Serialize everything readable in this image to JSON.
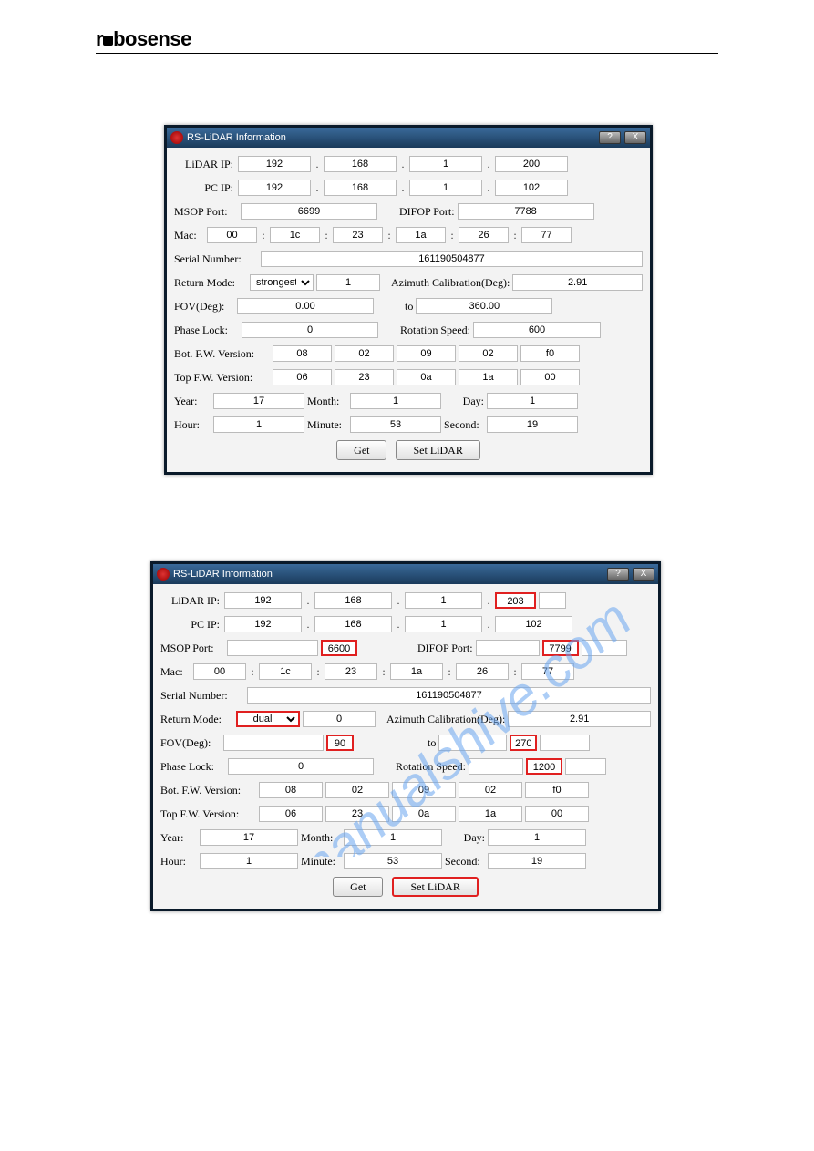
{
  "brand": "robosense",
  "watermark": "manualshive.com",
  "window_title": "RS-LiDAR Information",
  "titlebar_help": "?",
  "titlebar_close": "X",
  "labels": {
    "lidar_ip": "LiDAR IP:",
    "pc_ip": "PC IP:",
    "msop": "MSOP Port:",
    "difop": "DIFOP Port:",
    "mac": "Mac:",
    "serial": "Serial Number:",
    "return_mode": "Return Mode:",
    "azimuth": "Azimuth Calibration(Deg):",
    "fov": "FOV(Deg):",
    "to": "to",
    "phase": "Phase Lock:",
    "rot": "Rotation Speed:",
    "bot_ver": "Bot. F.W. Version:",
    "top_ver": "Top  F.W. Version:",
    "year": "Year:",
    "month": "Month:",
    "day": "Day:",
    "hour": "Hour:",
    "minute": "Minute:",
    "second": "Second:",
    "get": "Get",
    "set": "Set LiDAR"
  },
  "dialog1": {
    "lidar_ip": [
      "192",
      "168",
      "1",
      "200"
    ],
    "pc_ip": [
      "192",
      "168",
      "1",
      "102"
    ],
    "msop": "6699",
    "difop": "7788",
    "mac": [
      "00",
      "1c",
      "23",
      "1a",
      "26",
      "77"
    ],
    "serial": "161190504877",
    "return_mode": "strongest",
    "return_val": "1",
    "azimuth": "2.91",
    "fov_from": "0.00",
    "fov_to": "360.00",
    "phase": "0",
    "rot": "600",
    "bot_ver": [
      "08",
      "02",
      "09",
      "02",
      "f0"
    ],
    "top_ver": [
      "06",
      "23",
      "0a",
      "1a",
      "00"
    ],
    "year": "17",
    "month": "1",
    "day": "1",
    "hour": "1",
    "minute": "53",
    "second": "19"
  },
  "dialog2": {
    "lidar_ip": [
      "192",
      "168",
      "1",
      "203"
    ],
    "pc_ip": [
      "192",
      "168",
      "1",
      "102"
    ],
    "msop": "6600",
    "difop": "7799",
    "mac": [
      "00",
      "1c",
      "23",
      "1a",
      "26",
      "77"
    ],
    "serial": "161190504877",
    "return_mode": "dual",
    "return_val": "0",
    "azimuth": "2.91",
    "fov_from": "90",
    "fov_to": "270",
    "phase": "0",
    "rot": "1200",
    "bot_ver": [
      "08",
      "02",
      "09",
      "02",
      "f0"
    ],
    "top_ver": [
      "06",
      "23",
      "0a",
      "1a",
      "00"
    ],
    "year": "17",
    "month": "1",
    "day": "1",
    "hour": "1",
    "minute": "53",
    "second": "19"
  }
}
